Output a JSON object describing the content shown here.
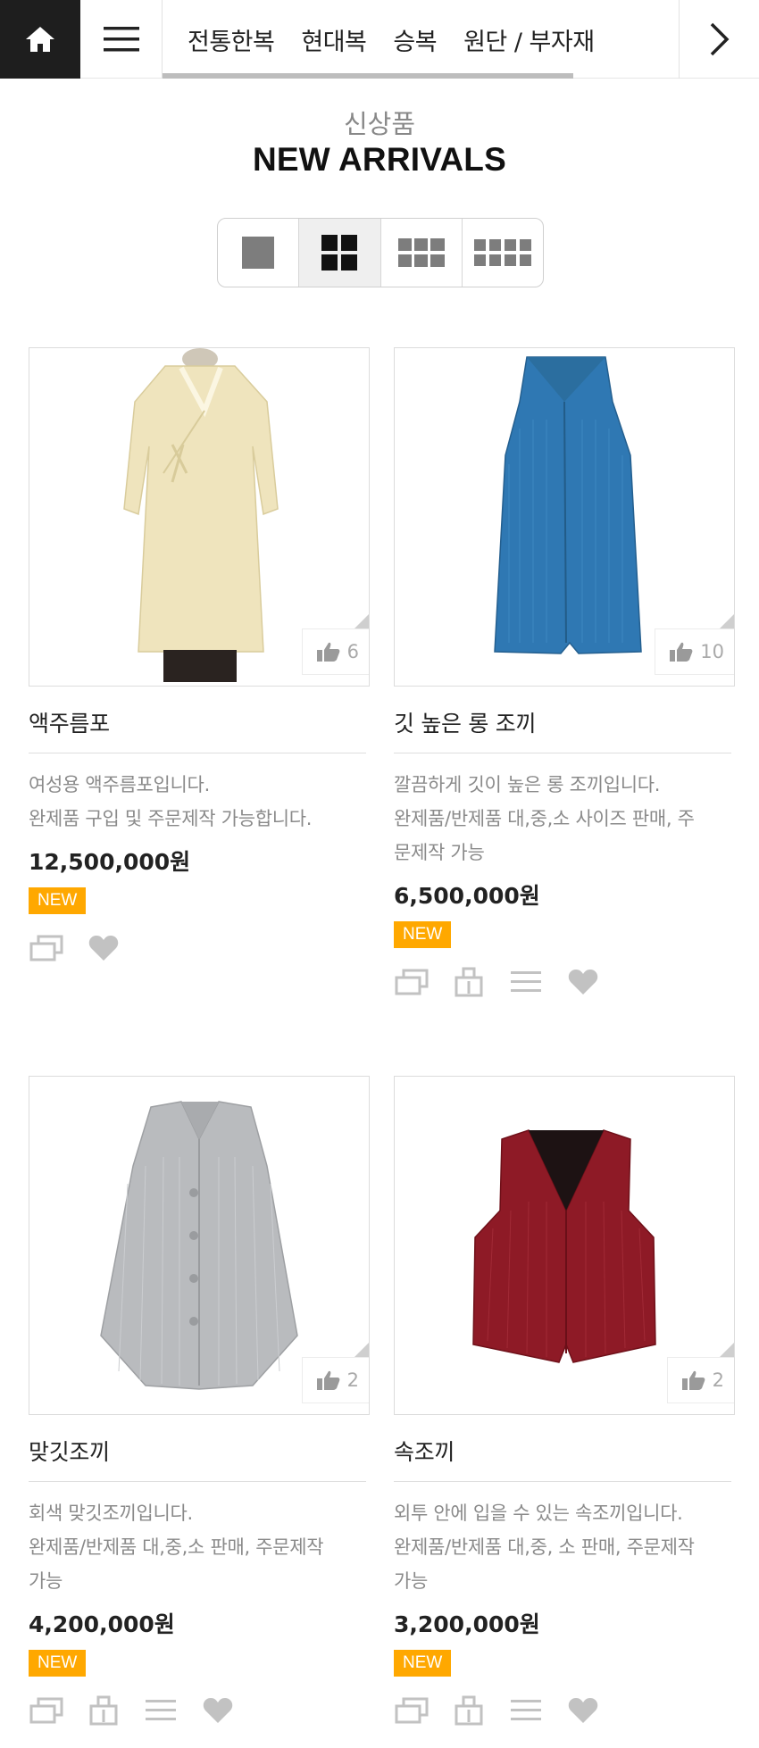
{
  "nav": {
    "categories": [
      "전통한복",
      "현대복",
      "승복",
      "원단 / 부자재"
    ]
  },
  "heading": {
    "kicker": "신상품",
    "title": "NEW ARRIVALS"
  },
  "view_modes": [
    "1-column",
    "2-column",
    "3-column",
    "4-column"
  ],
  "active_view": "2-column",
  "products": [
    {
      "name": "액주름포",
      "desc": [
        "여성용 액주름포입니다.",
        "완제품 구입 및 주문제작 가능합니다."
      ],
      "price": "12,500,000원",
      "badge": "NEW",
      "likes": "6",
      "color": "#efe4bd",
      "actions": [
        "compare-icon",
        "heart-icon"
      ]
    },
    {
      "name": "깃 높은 롱 조끼",
      "desc": [
        "깔끔하게 깃이 높은 롱 조끼입니다.",
        "완제품/반제품 대,중,소 사이즈 판매, 주",
        "문제작 가능"
      ],
      "price": "6,500,000원",
      "badge": "NEW",
      "likes": "10",
      "color": "#2f78b3",
      "actions": [
        "compare-icon",
        "cart-icon",
        "list-icon",
        "heart-icon"
      ]
    },
    {
      "name": "맞깃조끼",
      "desc": [
        "회색 맞깃조끼입니다.",
        "완제품/반제품 대,중,소 판매, 주문제작",
        "가능"
      ],
      "price": "4,200,000원",
      "badge": "NEW",
      "likes": "2",
      "color": "#b9bbbe",
      "actions": [
        "compare-icon",
        "cart-icon",
        "list-icon",
        "heart-icon"
      ]
    },
    {
      "name": "속조끼",
      "desc": [
        "외투 안에 입을 수 있는 속조끼입니다.",
        "완제품/반제품 대,중, 소 판매, 주문제작",
        "가능"
      ],
      "price": "3,200,000원",
      "badge": "NEW",
      "likes": "2",
      "color": "#8e1a26",
      "actions": [
        "compare-icon",
        "cart-icon",
        "list-icon",
        "heart-icon"
      ]
    }
  ]
}
